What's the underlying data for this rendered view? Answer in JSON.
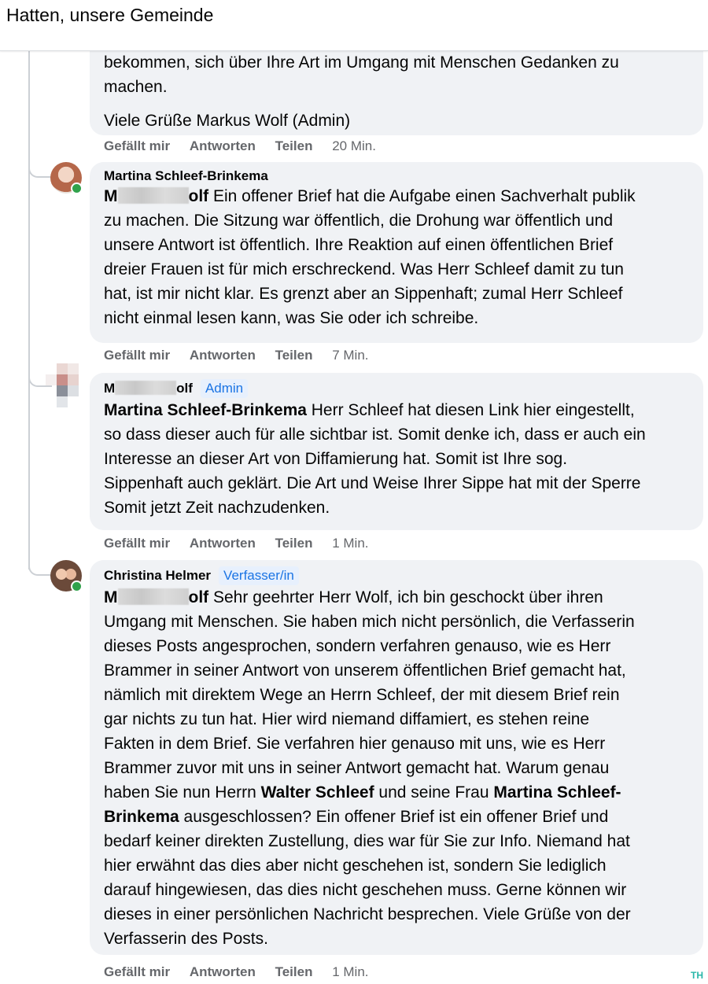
{
  "header": {
    "title": "Hatten, unsere Gemeinde"
  },
  "comments": [
    {
      "lines": [
        "bekommen, sich über Ihre Art im Umgang mit Menschen Gedanken zu",
        "machen.",
        "Viele Grüße Markus Wolf (Admin)"
      ],
      "actions": {
        "like": "Gefällt mir",
        "reply": "Antworten",
        "share": "Teilen",
        "time": "20 Min."
      }
    },
    {
      "author": "Martina Schleef-Brinkema",
      "mention_start": "M",
      "mention_end": "olf",
      "text_first": "Ein offener Brief hat die Aufgabe einen Sachverhalt publik",
      "lines": [
        "zu machen. Die Sitzung war öffentlich, die Drohung war öffentlich und",
        "unsere Antwort ist öffentlich. Ihre Reaktion auf einen öffentlichen Brief",
        "dreier Frauen ist für mich erschreckend. Was Herr Schleef damit zu tun",
        "hat, ist mir nicht klar. Es grenzt aber an Sippenhaft; zumal Herr Schleef",
        "nicht einmal lesen kann, was Sie oder ich schreibe."
      ],
      "actions": {
        "like": "Gefällt mir",
        "reply": "Antworten",
        "share": "Teilen",
        "time": "7 Min."
      }
    },
    {
      "author_start": "M",
      "author_end": "olf",
      "badge": "Admin",
      "mention": "Martina Schleef-Brinkema",
      "text_first": "Herr Schleef hat diesen Link hier eingestellt,",
      "lines": [
        "so dass dieser auch für alle sichtbar ist. Somit denke ich, dass er auch ein",
        "Interesse an dieser Art von Diffamierung hat. Somit ist Ihre sog.",
        "Sippenhaft auch geklärt. Die Art und Weise Ihrer Sippe hat mit der Sperre",
        "Somit jetzt Zeit nachzudenken."
      ],
      "actions": {
        "like": "Gefällt mir",
        "reply": "Antworten",
        "share": "Teilen",
        "time": "1 Min."
      }
    },
    {
      "author": "Christina Helmer",
      "badge": "Verfasser/in",
      "mention_start": "M",
      "mention_end": "olf",
      "text_first": "Sehr geehrter Herr Wolf, ich bin geschockt über ihren",
      "lines": [
        "Umgang mit Menschen. Sie haben mich nicht persönlich, die Verfasserin",
        "dieses Posts angesprochen, sondern verfahren genauso, wie es Herr",
        "Brammer in seiner Antwort von unserem öffentlichen Brief gemacht hat,",
        "nämlich mit direktem Wege an Herrn Schleef, der mit diesem Brief rein",
        "gar nichts zu tun hat. Hier wird niemand diffamiert, es stehen reine",
        "Fakten in dem Brief. Sie verfahren hier genauso mit uns, wie es Herr",
        "Brammer zuvor mit uns in seiner Antwort gemacht hat. Warum genau"
      ],
      "line_bold_a_pre": "haben Sie nun Herrn ",
      "line_bold_a_b1": "Walter Schleef",
      "line_bold_a_mid": " und seine Frau ",
      "line_bold_a_b2": "Martina Schleef-",
      "line_bold_b_b": "Brinkema",
      "line_bold_b_post": " ausgeschlossen? Ein offener Brief ist ein offener Brief und",
      "lines_after": [
        "bedarf keiner direkten Zustellung, dies war für Sie zur Info. Niemand hat",
        "hier erwähnt das dies aber nicht geschehen ist, sondern Sie lediglich",
        "darauf hingewiesen, das dies nicht geschehen muss. Gerne können wir",
        "dieses in einer persönlichen Nachricht besprechen. Viele Grüße von der",
        "Verfasserin des Posts."
      ],
      "actions": {
        "like": "Gefällt mir",
        "reply": "Antworten",
        "share": "Teilen",
        "time": "1 Min."
      }
    }
  ],
  "watermark": "TH",
  "colors": {
    "bubble": "#f0f2f5",
    "badge_text": "#1b74e4",
    "meta": "#65676b",
    "online": "#31a24c"
  }
}
